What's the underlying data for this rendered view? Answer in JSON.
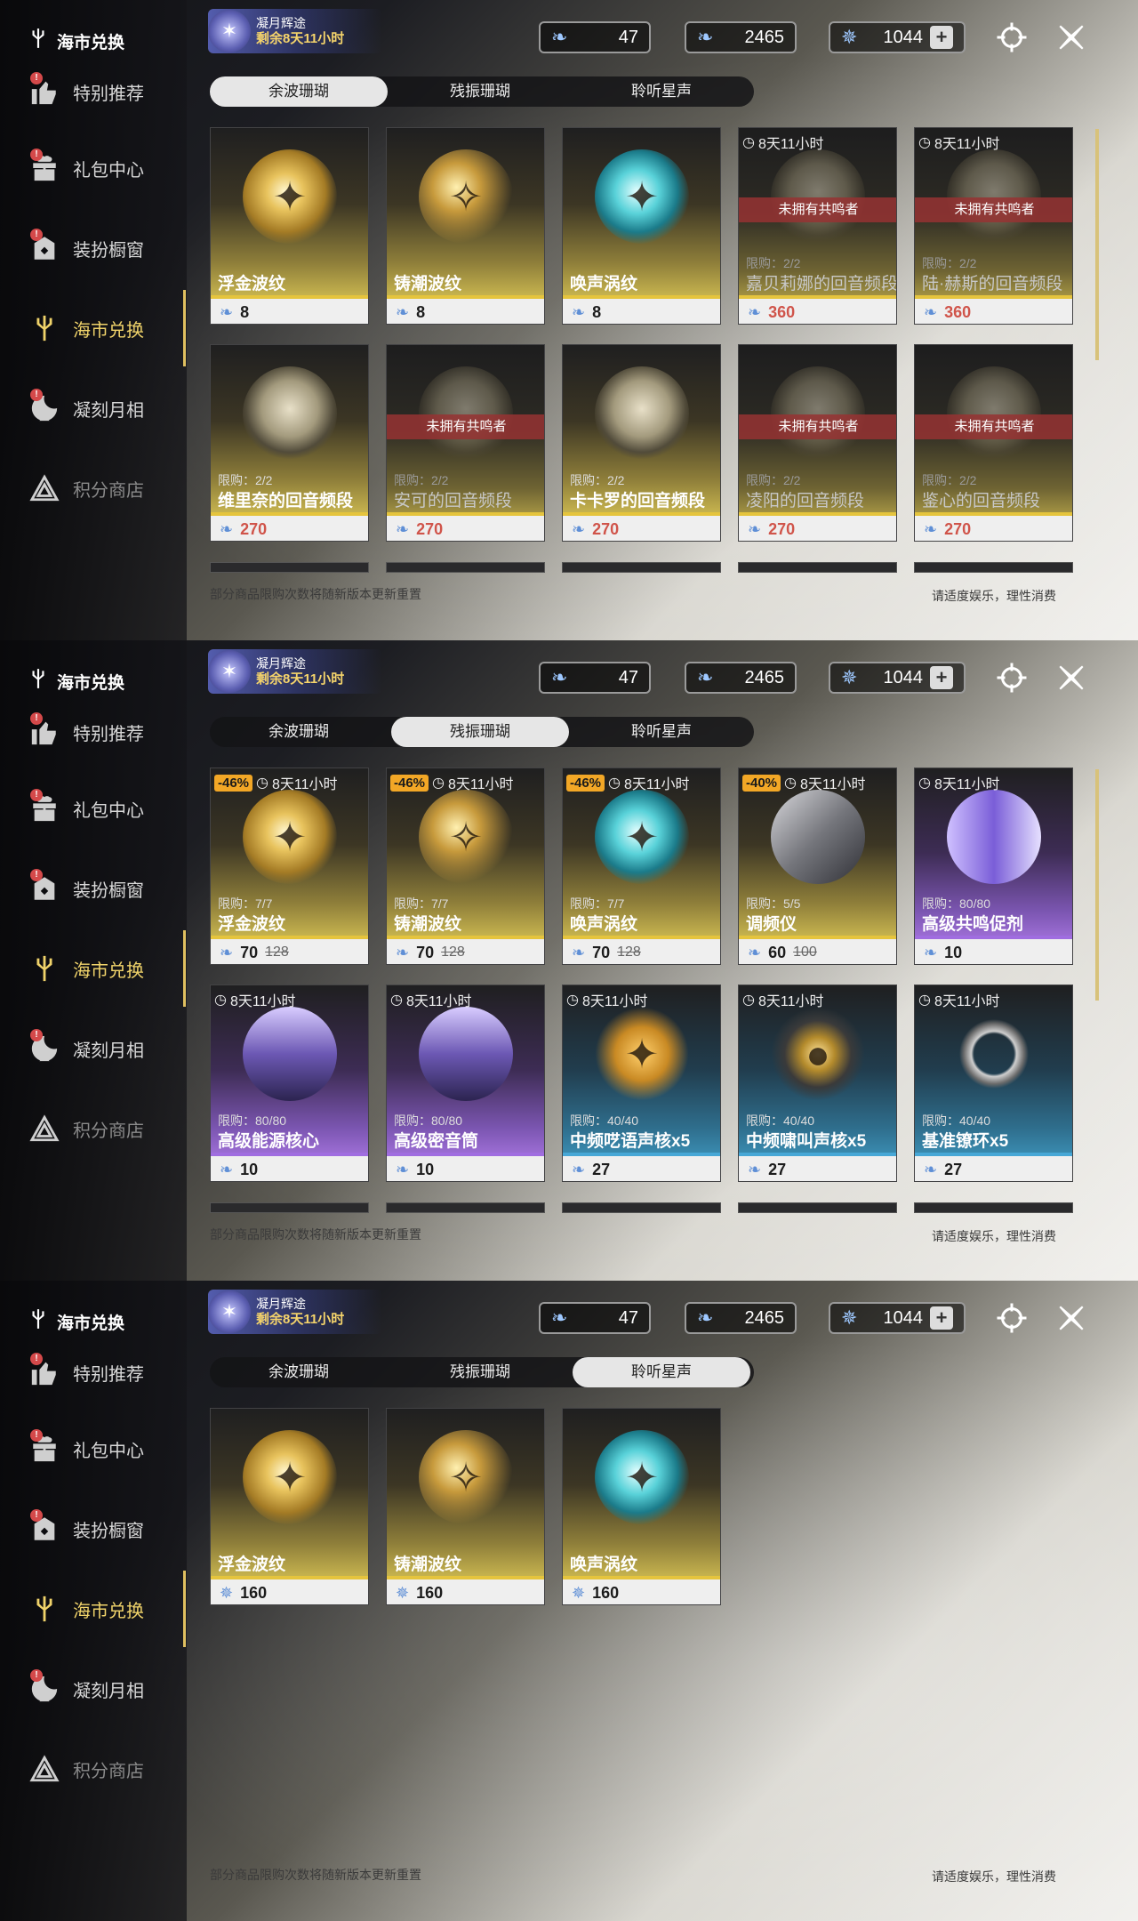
{
  "sidebar": {
    "logo": "海市兑换",
    "items": [
      {
        "label": "特别推荐",
        "icon": "thumbs-up-icon",
        "badge": true
      },
      {
        "label": "礼包中心",
        "icon": "gift-icon",
        "badge": true
      },
      {
        "label": "装扮橱窗",
        "icon": "wardrobe-icon",
        "badge": true
      },
      {
        "label": "海市兑换",
        "icon": "coral-icon",
        "badge": false,
        "active": true
      },
      {
        "label": "凝刻月相",
        "icon": "moon-crest-icon",
        "badge": true
      },
      {
        "label": "积分商店",
        "icon": "triangle-shop-icon",
        "badge": false,
        "dim": true
      }
    ]
  },
  "event": {
    "line1": "凝月辉途",
    "line2": "剩余8天11小时"
  },
  "currencies": [
    {
      "icon": "lustrous-coral-icon",
      "value": "47"
    },
    {
      "icon": "oscillated-coral-icon",
      "value": "2465"
    },
    {
      "icon": "astrite-icon",
      "value": "1044"
    }
  ],
  "tabs": [
    "余波珊瑚",
    "残振珊瑚",
    "聆听星声"
  ],
  "footer": {
    "left": "部分商品限购次数将随新版本更新重置",
    "right": "请适度娱乐，理性消费"
  },
  "screens": [
    {
      "selected_tab": 0,
      "cards": [
        {
          "name": "浮金波纹",
          "price": "8",
          "art": "gold"
        },
        {
          "name": "铸潮波纹",
          "price": "8",
          "art": "gold2"
        },
        {
          "name": "唤声涡纹",
          "price": "8",
          "art": "teal"
        },
        {
          "name": "嘉贝莉娜的回音频段",
          "timer": "8天11小时",
          "ribbon": "未拥有共鸣者",
          "limit": "限购：2/2",
          "price": "360",
          "art": "portrait-dim",
          "dim": true,
          "red": true
        },
        {
          "name": "陆·赫斯的回音频段",
          "timer": "8天11小时",
          "ribbon": "未拥有共鸣者",
          "limit": "限购：2/2",
          "price": "360",
          "art": "portrait-dim",
          "dim": true,
          "red": true
        },
        {
          "name": "维里奈的回音频段",
          "limit": "限购：2/2",
          "price": "270",
          "art": "portrait",
          "red": true
        },
        {
          "name": "安可的回音频段",
          "ribbon": "未拥有共鸣者",
          "limit": "限购：2/2",
          "price": "270",
          "art": "portrait-dim",
          "dim": true,
          "red": true
        },
        {
          "name": "卡卡罗的回音频段",
          "limit": "限购：2/2",
          "price": "270",
          "art": "portrait",
          "red": true
        },
        {
          "name": "凌阳的回音频段",
          "ribbon": "未拥有共鸣者",
          "limit": "限购：2/2",
          "price": "270",
          "art": "portrait-dim",
          "dim": true,
          "red": true
        },
        {
          "name": "鉴心的回音频段",
          "ribbon": "未拥有共鸣者",
          "limit": "限购：2/2",
          "price": "270",
          "art": "portrait-dim",
          "dim": true,
          "red": true
        }
      ]
    },
    {
      "selected_tab": 1,
      "cards": [
        {
          "name": "浮金波纹",
          "discount": "-46%",
          "timer": "8天11小时",
          "limit": "限购：7/7",
          "price": "70",
          "old": "128",
          "art": "gold",
          "bg": "gold"
        },
        {
          "name": "铸潮波纹",
          "discount": "-46%",
          "timer": "8天11小时",
          "limit": "限购：7/7",
          "price": "70",
          "old": "128",
          "art": "gold2",
          "bg": "gold"
        },
        {
          "name": "唤声涡纹",
          "discount": "-46%",
          "timer": "8天11小时",
          "limit": "限购：7/7",
          "price": "70",
          "old": "128",
          "art": "teal",
          "bg": "gold"
        },
        {
          "name": "调频仪",
          "discount": "-40%",
          "timer": "8天11小时",
          "limit": "限购：5/5",
          "price": "60",
          "old": "100",
          "art": "device",
          "bg": "gold"
        },
        {
          "name": "高级共鸣促剂",
          "timer": "8天11小时",
          "limit": "限购：80/80",
          "price": "10",
          "art": "vial",
          "bg": "purple"
        },
        {
          "name": "高级能源核心",
          "timer": "8天11小时",
          "limit": "限购：80/80",
          "price": "10",
          "art": "capsule",
          "bg": "purple"
        },
        {
          "name": "高级密音筒",
          "timer": "8天11小时",
          "limit": "限购：80/80",
          "price": "10",
          "art": "capsule",
          "bg": "purple"
        },
        {
          "name": "中频呓语声核x5",
          "timer": "8天11小时",
          "limit": "限购：40/40",
          "price": "27",
          "art": "star",
          "bg": "blue"
        },
        {
          "name": "中频啸叫声核x5",
          "timer": "8天11小时",
          "limit": "限购：40/40",
          "price": "27",
          "art": "core",
          "bg": "blue"
        },
        {
          "name": "基准镣环x5",
          "timer": "8天11小时",
          "limit": "限购：40/40",
          "price": "27",
          "art": "ring",
          "bg": "blue"
        }
      ]
    },
    {
      "selected_tab": 2,
      "cards": [
        {
          "name": "浮金波纹",
          "price": "160",
          "art": "gold",
          "astrite": true
        },
        {
          "name": "铸潮波纹",
          "price": "160",
          "art": "gold2",
          "astrite": true
        },
        {
          "name": "唤声涡纹",
          "price": "160",
          "art": "teal",
          "astrite": true
        }
      ]
    }
  ]
}
